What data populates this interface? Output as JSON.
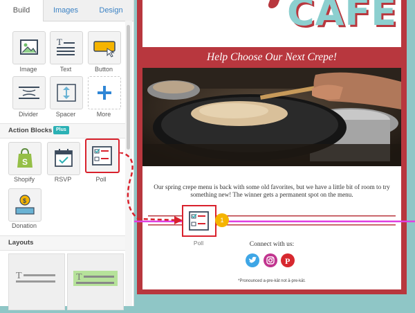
{
  "tabs": [
    "Build",
    "Images",
    "Design"
  ],
  "build_blocks": [
    {
      "label": "Image",
      "icon": "image-icon"
    },
    {
      "label": "Text",
      "icon": "text-icon"
    },
    {
      "label": "Button",
      "icon": "button-icon"
    },
    {
      "label": "Divider",
      "icon": "divider-icon"
    },
    {
      "label": "Spacer",
      "icon": "spacer-icon"
    },
    {
      "label": "More",
      "icon": "plus-icon"
    }
  ],
  "action_blocks": {
    "title": "Action Blocks",
    "badge": "Plus",
    "items": [
      {
        "label": "Shopify",
        "icon": "shopify-icon"
      },
      {
        "label": "RSVP",
        "icon": "calendar-icon"
      },
      {
        "label": "Poll",
        "icon": "poll-icon"
      },
      {
        "label": "Donation",
        "icon": "donation-icon"
      }
    ]
  },
  "layouts": {
    "title": "Layouts"
  },
  "email": {
    "logo": "CAFE",
    "headline": "Help Choose Our Next Crepe!",
    "body": "Our spring crepe menu is back with some old favorites, but we have a little bit of room to try something new! The winner gets a permanent spot on the menu.",
    "drop_label": "Poll",
    "connect": "Connect with us:",
    "footnote": "*Pronounced a-pre-kāt not ā-pre-kāt."
  },
  "step_marker": "1",
  "colors": {
    "accent": "#b8373e",
    "highlight": "#d9212c",
    "guide": "#e040e0",
    "teal": "#8ccfcf"
  }
}
